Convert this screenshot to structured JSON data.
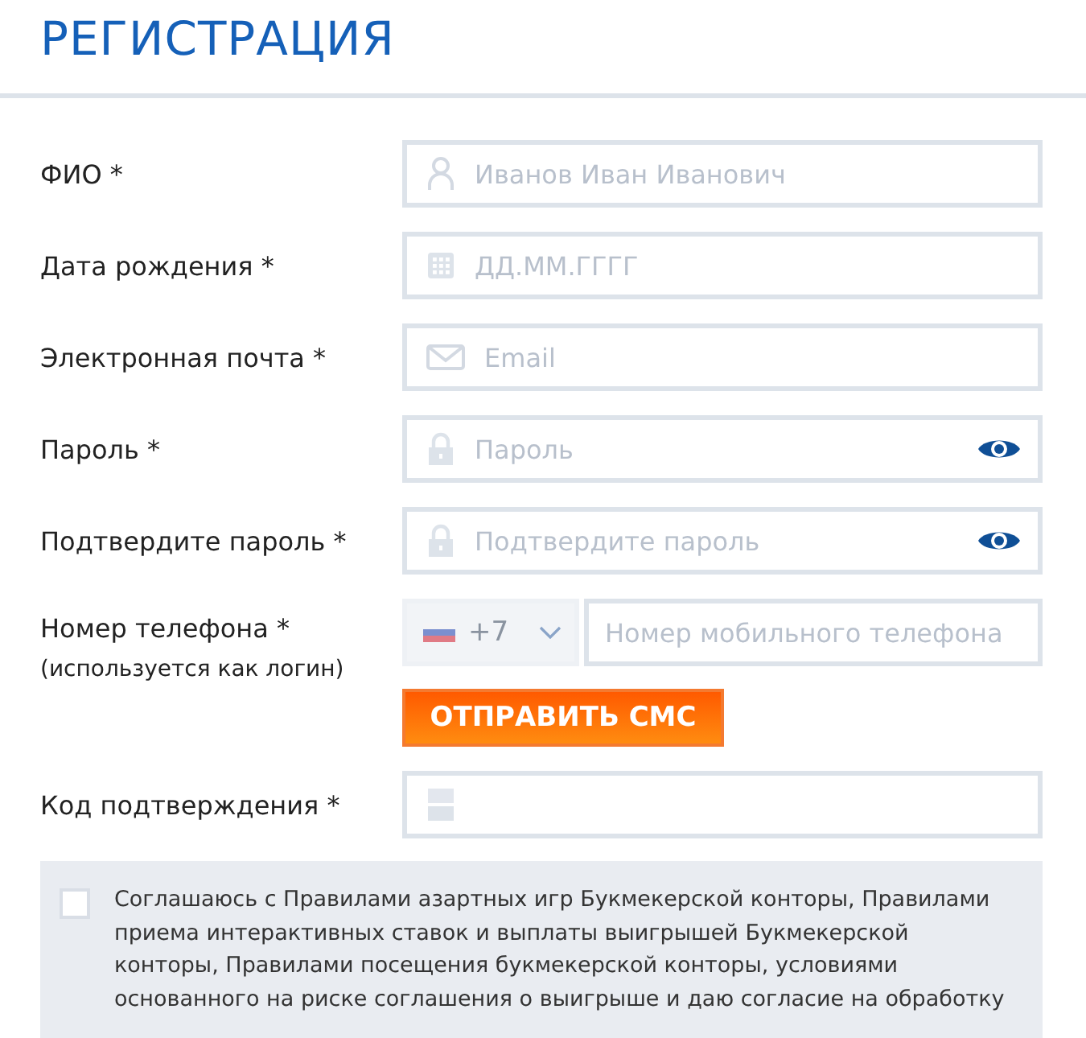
{
  "title": "РЕГИСТРАЦИЯ",
  "fields": [
    {
      "kind": "name",
      "label": "ФИО *",
      "placeholder": "Иванов Иван Иванович"
    },
    {
      "kind": "date",
      "label": "Дата рождения *",
      "placeholder": "ДД.ММ.ГГГГ"
    },
    {
      "kind": "email",
      "label": "Электронная почта *",
      "placeholder": "Email"
    },
    {
      "kind": "password",
      "label": "Пароль *",
      "placeholder": "Пароль"
    },
    {
      "kind": "password",
      "label": "Подтвердите пароль *",
      "placeholder": "Подтвердите пароль"
    },
    {
      "kind": "phone",
      "label": "Номер телефона *",
      "note": "(используется как логин)",
      "country_code": "+7",
      "placeholder": "Номер мобильного телефона",
      "button": "ОТПРАВИТЬ СМС"
    },
    {
      "kind": "code",
      "label": "Код подтверждения *"
    }
  ],
  "agreement": {
    "checked": false,
    "text": "Соглашаюсь с Правилами азартных игр Букмекерской конторы, Правилами приема интерактивных ставок и выплаты выигрышей Букмекерской конторы, Правилами посещения букмекерской конторы, условиями основанного на риске соглашения о выигрыше и даю согласие на обработку"
  }
}
